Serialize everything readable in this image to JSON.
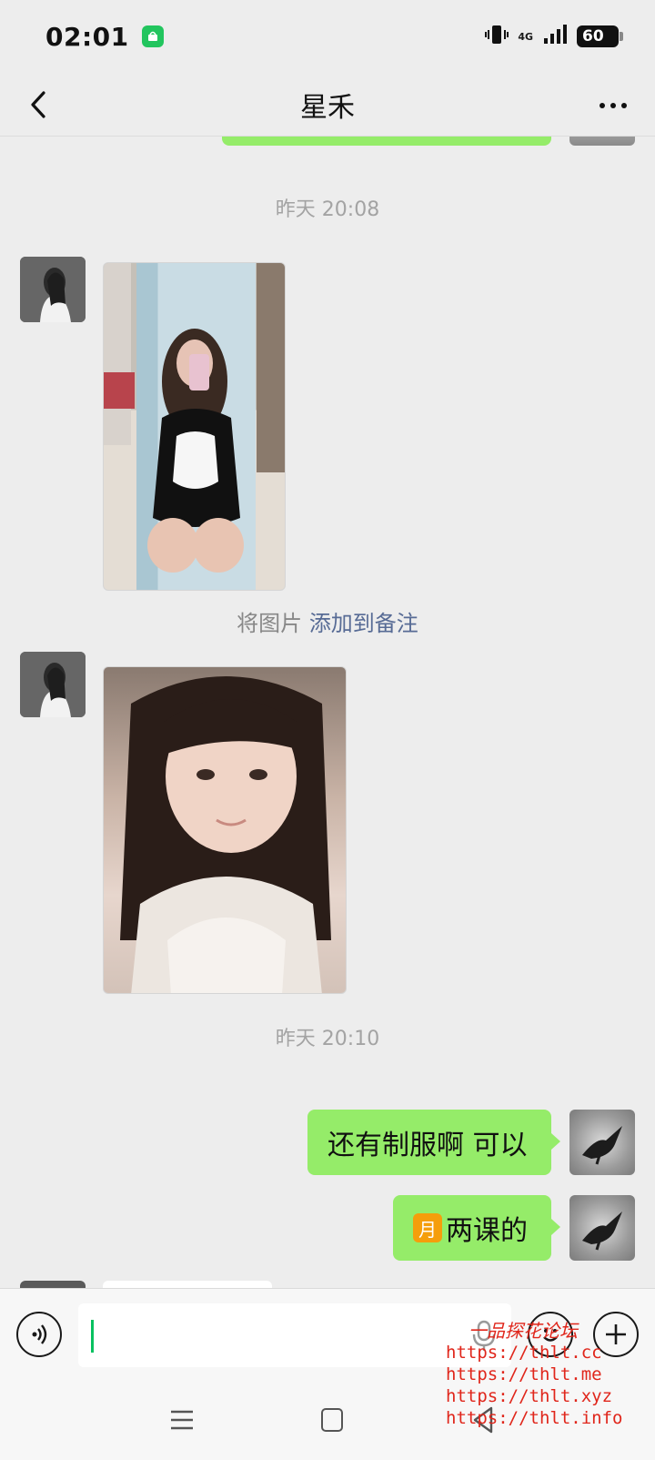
{
  "status_bar": {
    "time": "02:01",
    "network": "4G",
    "battery": "60"
  },
  "nav": {
    "title": "星禾"
  },
  "chat": {
    "timestamp_1": "昨天 20:08",
    "system_note_prefix": "将图片",
    "system_note_link": "添加到备注",
    "timestamp_2": "昨天 20:10",
    "messages": [
      {
        "from": "me",
        "text": "还有制服啊 可以"
      },
      {
        "from": "me",
        "emoji": "月",
        "text": "两课的"
      }
    ]
  },
  "watermark": {
    "title": "一品探花论坛",
    "links": [
      "https://thlt.cc",
      "https://thlt.me",
      "https://thlt.xyz",
      "https://thlt.info"
    ]
  },
  "colors": {
    "bubble_me": "#95ec69",
    "link": "#576b95",
    "caret": "#07c160",
    "watermark": "#e0261b"
  }
}
